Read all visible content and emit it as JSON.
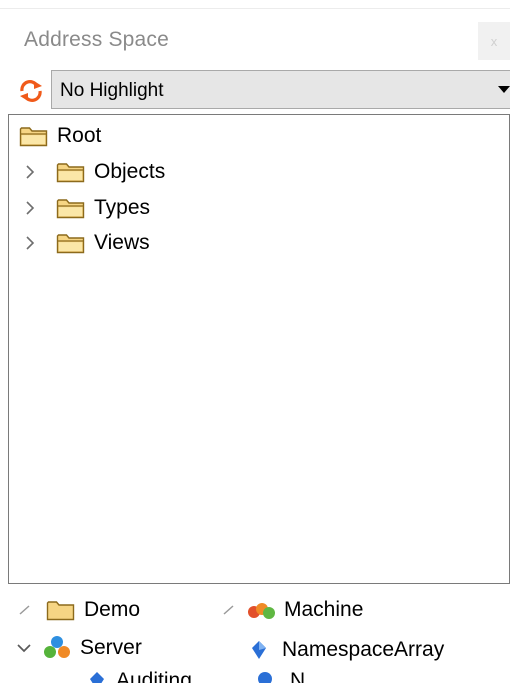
{
  "panel": {
    "title": "Address Space",
    "close_label": "x"
  },
  "toolbar": {
    "refresh_icon": "refresh-icon",
    "highlight_value": "No Highlight"
  },
  "tree": {
    "root": {
      "label": "Root",
      "icon": "folder-icon"
    },
    "children": [
      {
        "label": "Objects",
        "icon": "folder-icon",
        "expander": "chevron-right-icon"
      },
      {
        "label": "Types",
        "icon": "folder-icon",
        "expander": "chevron-right-icon"
      },
      {
        "label": "Views",
        "icon": "folder-icon",
        "expander": "chevron-right-icon"
      }
    ]
  },
  "background_tree": {
    "items": [
      {
        "label": "Demo",
        "icon": "folder-icon"
      },
      {
        "label": "Machine",
        "icon": "object-icon"
      },
      {
        "label": "Server",
        "icon": "server-icon"
      },
      {
        "label": "NamespaceArray",
        "icon": "variable-icon"
      },
      {
        "label": "Auditing",
        "icon": "variable-icon"
      },
      {
        "label": "N",
        "icon": "variable-icon"
      }
    ]
  },
  "colors": {
    "folder_fill": "#f6d584",
    "folder_stroke": "#8c6a1c",
    "refresh_orange": "#f05a1a",
    "variable_blue": "#2a6fd6"
  }
}
